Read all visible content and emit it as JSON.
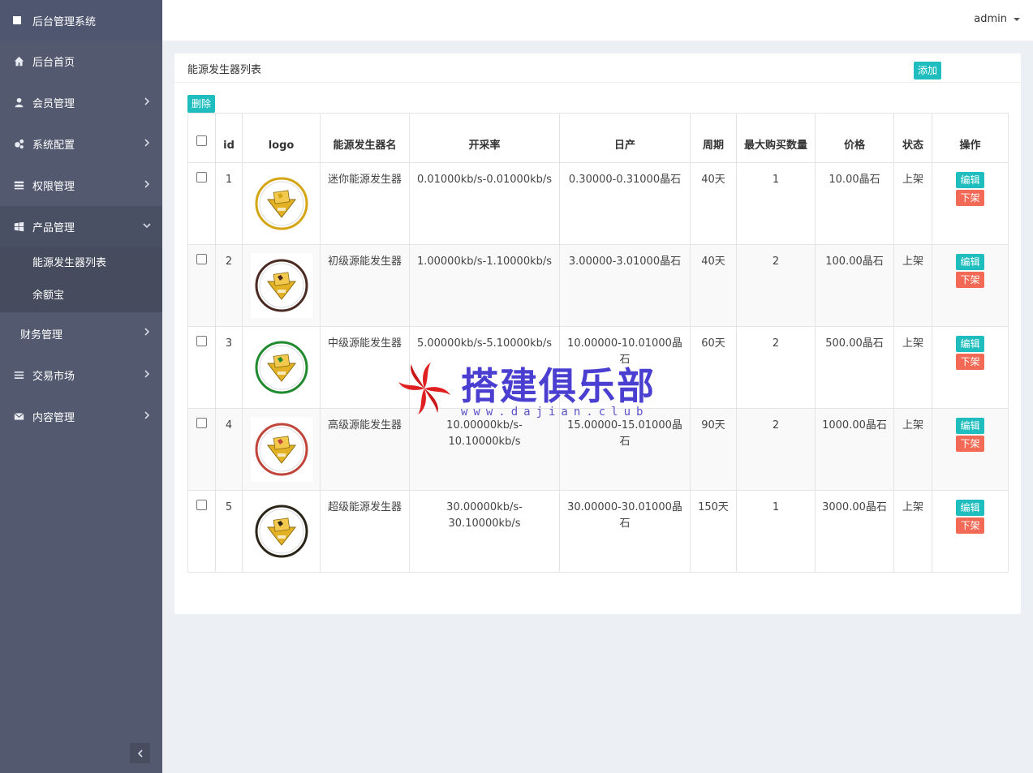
{
  "app": {
    "title": "后台管理系统"
  },
  "header": {
    "user": "admin"
  },
  "sidebar": {
    "items": [
      {
        "label": "后台首页",
        "icon": "home-icon"
      },
      {
        "label": "会员管理",
        "icon": "user-icon"
      },
      {
        "label": "系统配置",
        "icon": "gears-icon"
      },
      {
        "label": "权限管理",
        "icon": "list-icon"
      },
      {
        "label": "产品管理",
        "icon": "windows-icon"
      },
      {
        "label": "财务管理",
        "icon": ""
      },
      {
        "label": "交易市场",
        "icon": "bars-icon"
      },
      {
        "label": "内容管理",
        "icon": "envelope-icon"
      }
    ],
    "sub_items": [
      {
        "label": "能源发生器列表"
      },
      {
        "label": "余额宝"
      }
    ]
  },
  "panel": {
    "title": "能源发生器列表",
    "add_label": "添加",
    "delete_label": "删除"
  },
  "table": {
    "headers": [
      "id",
      "logo",
      "能源发生器名",
      "开采率",
      "日产",
      "周期",
      "最大购买数量",
      "价格",
      "状态",
      "操作"
    ],
    "edit_label": "编辑",
    "offline_label": "下架",
    "rows": [
      {
        "id": "1",
        "name": "迷你能源发生器",
        "rate": "0.01000kb/s-0.01000kb/s",
        "daily": "0.30000-0.31000晶石",
        "period": "40天",
        "max": "1",
        "price": "10.00晶石",
        "status": "上架",
        "logo_color": "#d4a514"
      },
      {
        "id": "2",
        "name": "初级源能发生器",
        "rate": "1.00000kb/s-1.10000kb/s",
        "daily": "3.00000-3.01000晶石",
        "period": "40天",
        "max": "2",
        "price": "100.00晶石",
        "status": "上架",
        "logo_color": "#4a2a22"
      },
      {
        "id": "3",
        "name": "中级源能发生器",
        "rate": "5.00000kb/s-5.10000kb/s",
        "daily": "10.00000-10.01000晶石",
        "period": "60天",
        "max": "2",
        "price": "500.00晶石",
        "status": "上架",
        "logo_color": "#1f8a2e"
      },
      {
        "id": "4",
        "name": "高级源能发生器",
        "rate": "10.00000kb/s-10.10000kb/s",
        "daily": "15.00000-15.01000晶石",
        "period": "90天",
        "max": "2",
        "price": "1000.00晶石",
        "status": "上架",
        "logo_color": "#c0453a"
      },
      {
        "id": "5",
        "name": "超级能源发生器",
        "rate": "30.00000kb/s-30.10000kb/s",
        "daily": "30.00000-30.01000晶石",
        "period": "150天",
        "max": "1",
        "price": "3000.00晶石",
        "status": "上架",
        "logo_color": "#2b2418"
      }
    ]
  },
  "watermark": {
    "text": "搭建俱乐部",
    "url": "www.dajian.club"
  },
  "colors": {
    "sidebar": "#535a6f",
    "accent_teal": "#1fbdbd",
    "accent_red": "#f26a55",
    "progress": "#2f96e6"
  }
}
